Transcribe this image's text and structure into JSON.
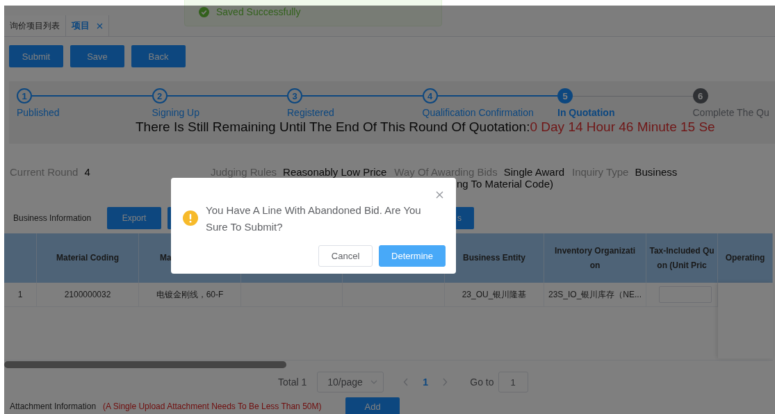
{
  "tabs": [
    {
      "label": "询价项目列表",
      "selected": false,
      "closable": false
    },
    {
      "label": "项目",
      "selected": true,
      "closable": true
    }
  ],
  "toast": {
    "message": "Saved Successfully"
  },
  "toolbar": [
    "Submit",
    "Save",
    "Back"
  ],
  "steps": [
    {
      "number": "1",
      "label": "Published",
      "finished": true,
      "selected": false
    },
    {
      "number": "2",
      "label": "Signing Up",
      "finished": true,
      "selected": false
    },
    {
      "number": "3",
      "label": "Registered",
      "finished": true,
      "selected": false
    },
    {
      "number": "4",
      "label": "Qualification Confirmation",
      "finished": true,
      "selected": false
    },
    {
      "number": "5",
      "label": "In Quotation",
      "finished": false,
      "selected": true
    },
    {
      "number": "6",
      "label": "Complete The Qu",
      "finished": false,
      "selected": false
    }
  ],
  "countdown": {
    "label": "There Is Still Remaining Until The End Of This Round Of Quotation:",
    "value": "0 Day 14 Hour 46 Minute 15 Se"
  },
  "info": [
    {
      "label": "Current Round",
      "value": "4"
    },
    {
      "label": "Judging Rules",
      "value": "Reasonably Low Price"
    },
    {
      "label": "Way Of Awarding Bids",
      "value": "Single Award"
    },
    {
      "label": "Inquiry Type",
      "value": "Business"
    }
  ],
  "info_continuation": "ng To Material Code)",
  "business": {
    "title": "Business Information",
    "buttons": [
      {
        "kind": "button",
        "label": "Export"
      },
      {
        "kind": "button"
      },
      {
        "kind": "button",
        "label": "s"
      }
    ]
  },
  "table": {
    "columns": [
      {
        "kind": "blank"
      },
      {
        "kind": "header",
        "lines": [
          "Material Coding"
        ]
      },
      {
        "kind": "cut",
        "lines": [
          "Ma"
        ]
      },
      {
        "kind": "blank"
      },
      {
        "kind": "blank"
      },
      {
        "kind": "header",
        "lines": [
          "Business Entity"
        ]
      },
      {
        "kind": "header",
        "lines": [
          "Inventory Organizati",
          "on"
        ]
      },
      {
        "kind": "header",
        "lines": [
          "Tax-Included Qu",
          "on (Unit Pric"
        ]
      },
      {
        "kind": "header",
        "lines": [
          "Operating"
        ]
      }
    ],
    "rows": [
      {
        "cells": [
          {
            "kind": "text",
            "text": "1"
          },
          {
            "kind": "text",
            "text": "2100000032"
          },
          {
            "kind": "text",
            "text": "电镀金刚线，60-F"
          },
          {
            "kind": "empty"
          },
          {
            "kind": "empty"
          },
          {
            "kind": "text",
            "text": "23_OU_银川隆基"
          },
          {
            "kind": "text",
            "text": "23S_IO_银川库存（NE..."
          },
          {
            "kind": "input"
          }
        ]
      }
    ]
  },
  "pagination": {
    "total": "Total 1",
    "page_size": "10/page",
    "pages": [
      {
        "label": "1",
        "selected": true
      }
    ],
    "goto_label": "Go to",
    "goto_value": "1"
  },
  "attachment": {
    "title": "Attachment Information",
    "note": "(A Single Upload Attachment Needs To Be Less Than 50M)",
    "button": "Add"
  },
  "dialog": {
    "message": "You Have A Line With Abandoned Bid. Are You Sure To Submit?",
    "buttons": [
      {
        "label": "Cancel",
        "primary": false
      },
      {
        "label": "Determine",
        "primary": true
      }
    ]
  }
}
